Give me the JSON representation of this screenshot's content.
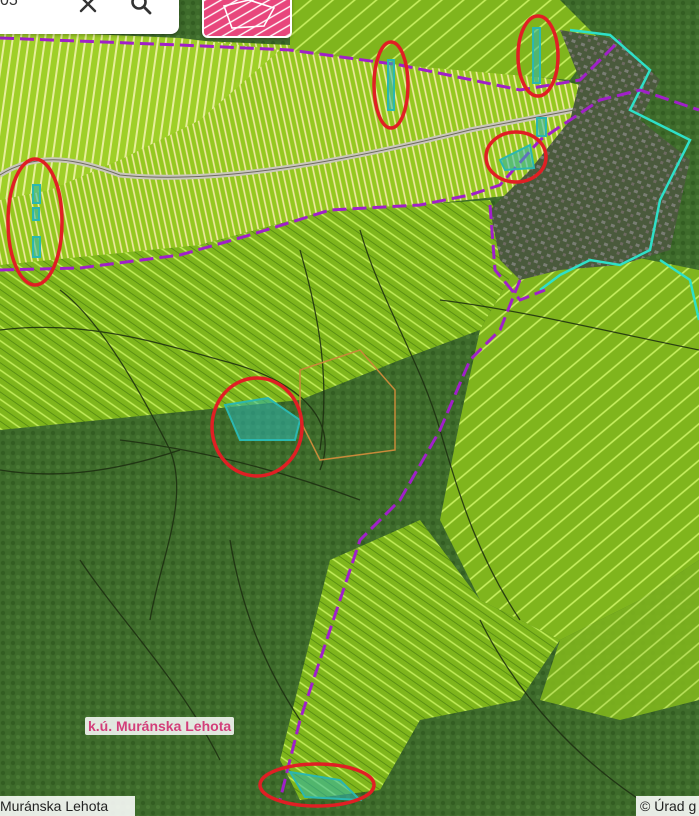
{
  "search": {
    "value": "05"
  },
  "controls": {
    "clear_icon": "close-icon",
    "search_icon": "search-icon",
    "layer_icon": "parcel-layer-icon"
  },
  "map": {
    "cadastral_area_label": "k.ú. Muránska Lehota",
    "bottom_left_text": "Muránska Lehota",
    "attribution": "© Úrad g",
    "colors": {
      "forest": "#3d6a2a",
      "parcel_fill": "#8fc81c",
      "parcel_lines": "#b6e64a",
      "boundary": "#a020c8",
      "highlight": "#2bb7b0",
      "marker": "#e01f24",
      "label": "#d33e7a"
    }
  }
}
